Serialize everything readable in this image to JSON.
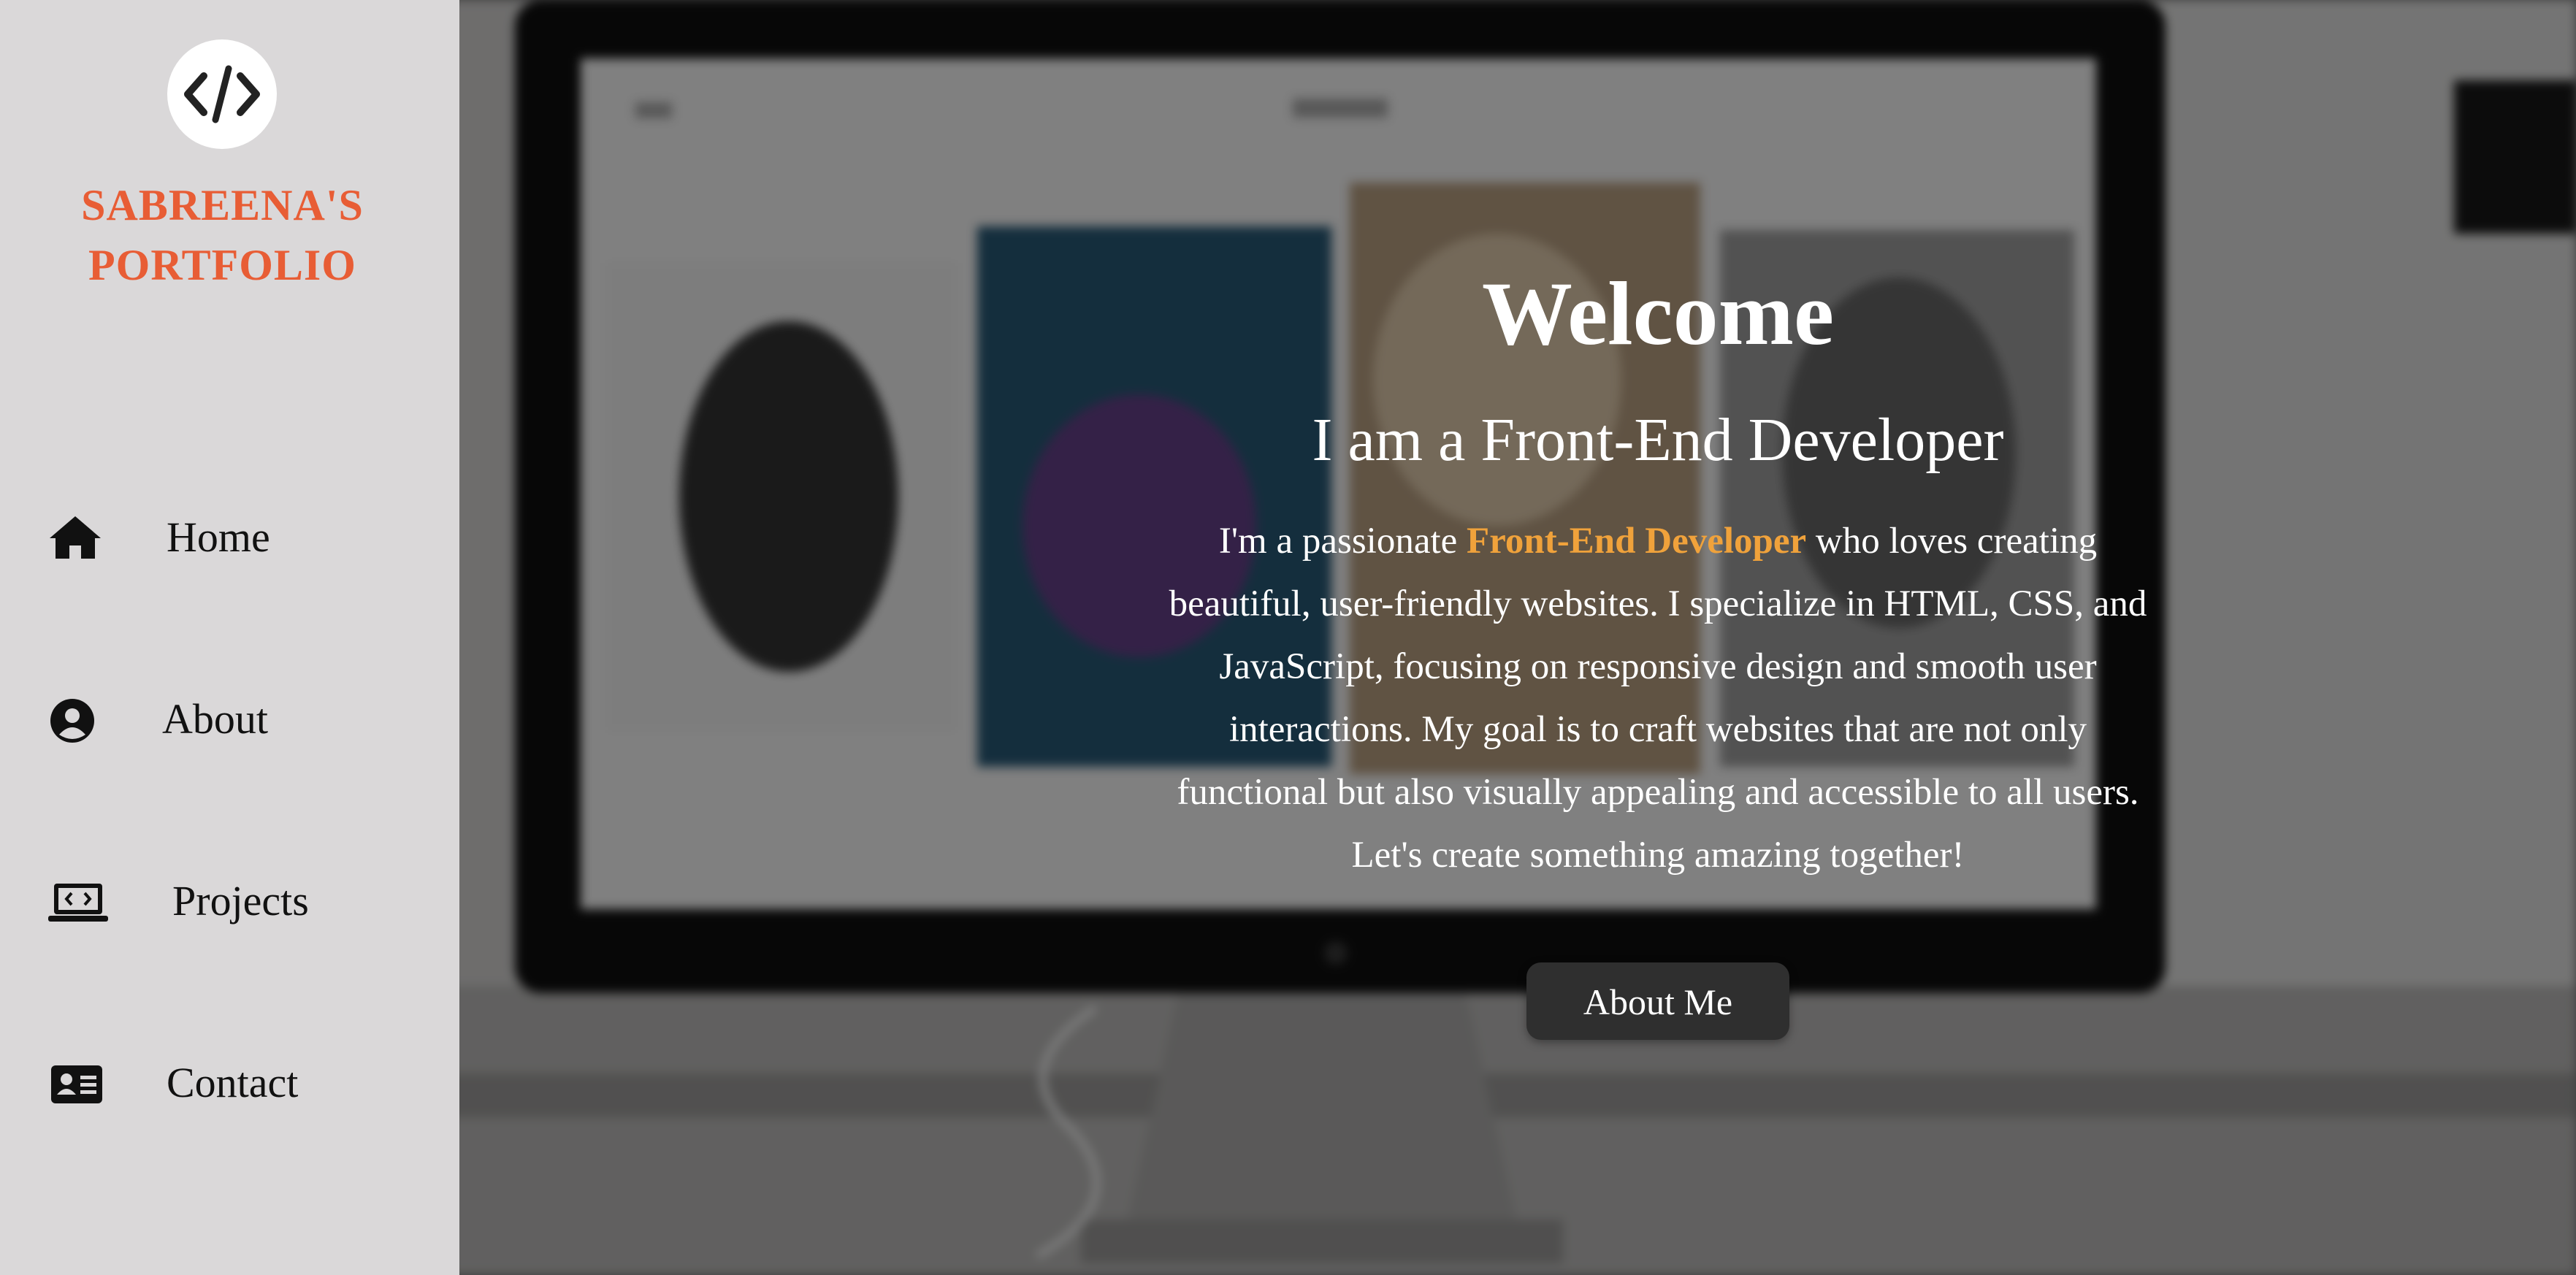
{
  "brand": {
    "logo_icon": "code-brackets-icon",
    "name_line1": "SABREENA'S",
    "name_line2": "PORTFOLIO",
    "color": "#e85d35"
  },
  "nav": {
    "items": [
      {
        "label": "Home",
        "icon": "home-icon"
      },
      {
        "label": "About",
        "icon": "user-circle-icon"
      },
      {
        "label": "Projects",
        "icon": "laptop-code-icon"
      },
      {
        "label": "Contact",
        "icon": "id-card-icon"
      }
    ]
  },
  "hero": {
    "title": "Welcome",
    "subtitle": "I am a Front-End Developer",
    "desc_before": "I'm a passionate ",
    "desc_highlight": "Front-End Developer",
    "desc_after": " who loves creating beautiful, user-friendly websites. I specialize in HTML, CSS, and JavaScript, focusing on responsive design and smooth user interactions. My goal is to craft websites that are not only functional but also visually appealing and accessible to all users. Let's create something amazing together!",
    "highlight_color": "#f0a23b",
    "button_label": "About Me"
  }
}
